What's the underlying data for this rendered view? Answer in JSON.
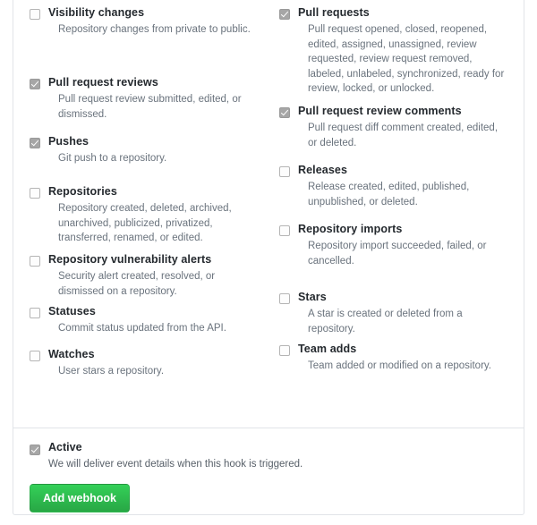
{
  "form": {
    "events_left_column": [
      {
        "name": "visibility-changes",
        "title": "Visibility changes",
        "description": "Repository changes from private to public.",
        "checked": false,
        "block_height": 78
      },
      {
        "name": "pull-request-reviews",
        "title": "Pull request reviews",
        "description": "Pull request review submitted, edited, or dismissed.",
        "checked": true,
        "block_height": 66
      },
      {
        "name": "pushes",
        "title": "Pushes",
        "description": "Git push to a repository.",
        "checked": true,
        "block_height": 56
      },
      {
        "name": "repositories",
        "title": "Repositories",
        "description": "Repository created, deleted, archived, unarchived, publicized, privatized, transferred, renamed, or edited.",
        "checked": false,
        "block_height": 76
      },
      {
        "name": "repository-vulnerability-alerts",
        "title": "Repository vulnerability alerts",
        "description": "Security alert created, resolved, or dismissed on a repository.",
        "checked": false,
        "block_height": 58
      },
      {
        "name": "statuses",
        "title": "Statuses",
        "description": "Commit status updated from the API.",
        "checked": false,
        "block_height": 48
      },
      {
        "name": "watches",
        "title": "Watches",
        "description": "User stars a repository.",
        "checked": false,
        "block_height": 46
      }
    ],
    "events_right_column": [
      {
        "name": "pull-requests",
        "title": "Pull requests",
        "description": "Pull request opened, closed, reopened, edited, assigned, unassigned, review requested, review request removed, labeled, unlabeled, synchronized, ready for review, locked, or unlocked.",
        "checked": true,
        "block_height": 110
      },
      {
        "name": "pull-request-review-comments",
        "title": "Pull request review comments",
        "description": "Pull request diff comment created, edited, or deleted.",
        "checked": true,
        "block_height": 66
      },
      {
        "name": "releases",
        "title": "Releases",
        "description": "Release created, edited, published, unpublished, or deleted.",
        "checked": false,
        "block_height": 66
      },
      {
        "name": "repository-imports",
        "title": "Repository imports",
        "description": "Repository import succeeded, failed, or cancelled.",
        "checked": false,
        "block_height": 76
      },
      {
        "name": "stars",
        "title": "Stars",
        "description": "A star is created or deleted from a repository.",
        "checked": false,
        "block_height": 58
      },
      {
        "name": "team-adds",
        "title": "Team adds",
        "description": "Team added or modified on a repository.",
        "checked": false,
        "block_height": 48
      }
    ],
    "active": {
      "title": "Active",
      "description": "We will deliver event details when this hook is triggered.",
      "checked": true
    },
    "submit": {
      "label": "Add webhook",
      "color": "#28a745"
    }
  }
}
